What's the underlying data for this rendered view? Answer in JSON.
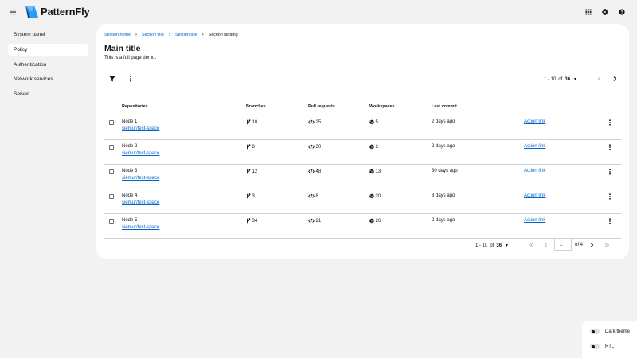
{
  "brand": {
    "name": "PatternFly"
  },
  "sidebar": {
    "items": [
      {
        "label": "System panel"
      },
      {
        "label": "Policy",
        "active": true
      },
      {
        "label": "Authentication"
      },
      {
        "label": "Network services"
      },
      {
        "label": "Server"
      }
    ]
  },
  "breadcrumb": {
    "items": [
      "Section home",
      "Section title",
      "Section title"
    ],
    "current": "Section landing"
  },
  "page": {
    "title": "Main title",
    "description": "This is a full page demo."
  },
  "top_pagination": {
    "range": "1 - 10",
    "of": "of",
    "total": "36"
  },
  "table": {
    "columns": [
      "Repositories",
      "Branches",
      "Pull requests",
      "Workspaces",
      "Last commit"
    ],
    "rows": [
      {
        "name": "Node 1",
        "link": "siemur/test-space",
        "branches": "10",
        "pull_requests": "25",
        "workspaces": "5",
        "last_commit": "2 days ago",
        "action": "Action link"
      },
      {
        "name": "Node 2",
        "link": "siemur/test-space",
        "branches": "8",
        "pull_requests": "30",
        "workspaces": "2",
        "last_commit": "2 days ago",
        "action": "Action link"
      },
      {
        "name": "Node 3",
        "link": "siemur/test-space",
        "branches": "12",
        "pull_requests": "48",
        "workspaces": "13",
        "last_commit": "30 days ago",
        "action": "Action link"
      },
      {
        "name": "Node 4",
        "link": "siemur/test-space",
        "branches": "3",
        "pull_requests": "8",
        "workspaces": "20",
        "last_commit": "8 days ago",
        "action": "Action link"
      },
      {
        "name": "Node 5",
        "link": "siemur/test-space",
        "branches": "34",
        "pull_requests": "21",
        "workspaces": "26",
        "last_commit": "2 days ago",
        "action": "Action link"
      }
    ]
  },
  "bottom_pagination": {
    "range": "1 - 10",
    "of": "of",
    "total": "36",
    "page": "1",
    "of_pages": "of 4"
  },
  "theme_panel": {
    "dark_label": "Dark theme",
    "rtl_label": "RTL"
  },
  "colors": {
    "link": "#0066cc",
    "page_bg": "#f2f2f2",
    "brand_blue": "#2b9af3"
  }
}
